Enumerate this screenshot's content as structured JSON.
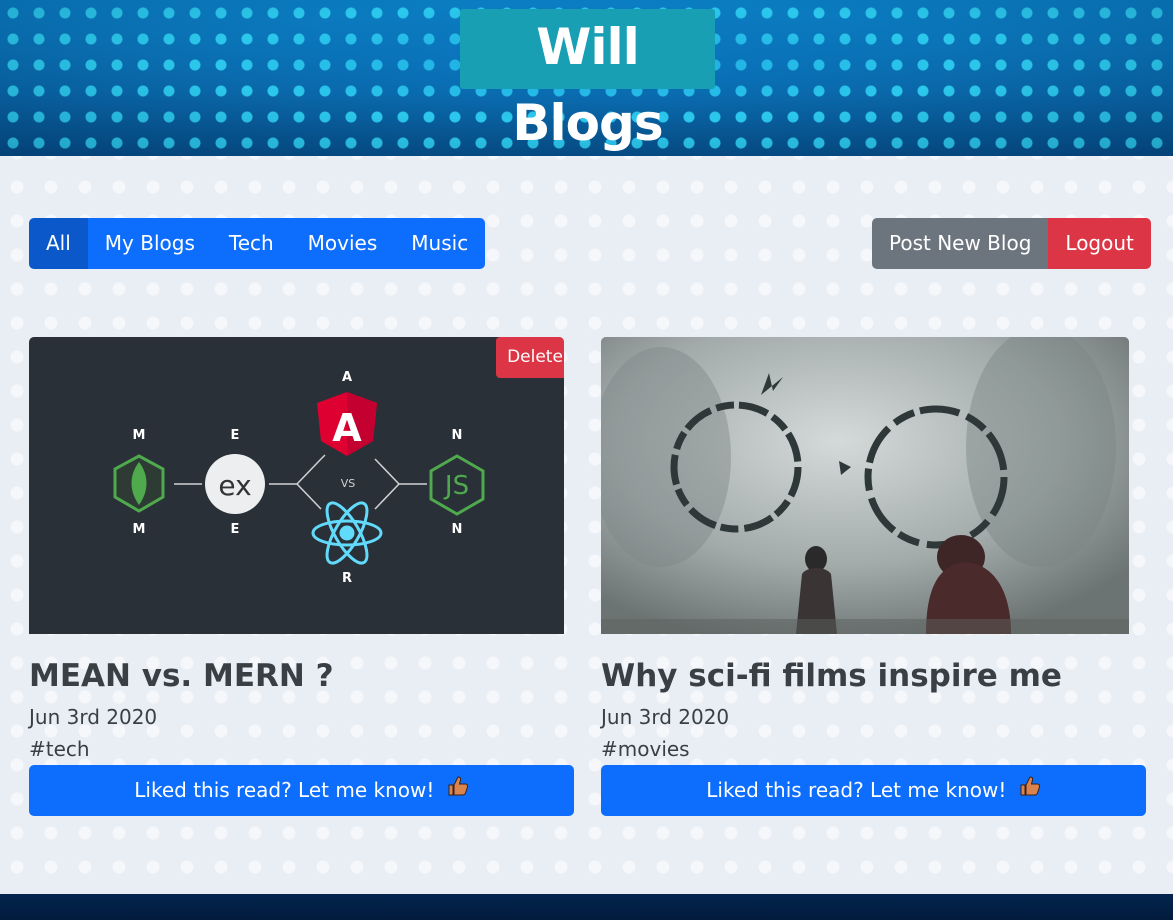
{
  "site": {
    "title": "Will Blogs"
  },
  "filters": [
    {
      "label": "All",
      "active": true
    },
    {
      "label": "My Blogs",
      "active": false
    },
    {
      "label": "Tech",
      "active": false
    },
    {
      "label": "Movies",
      "active": false
    },
    {
      "label": "Music",
      "active": false
    }
  ],
  "actions": {
    "post_label": "Post New Blog",
    "logout_label": "Logout"
  },
  "posts": [
    {
      "title": "MEAN vs. MERN ?",
      "date": "Jun 3rd 2020",
      "tag": "#tech",
      "delete_label": "Delete",
      "like_label": "Liked this read? Let me know!",
      "image": {
        "top_letter": "A",
        "left_letters": [
          "M",
          "E"
        ],
        "right_letter": "N",
        "bottom_letter": "R",
        "ex_label": "ex",
        "vs_label": "VS",
        "js_label": "JS",
        "angular_letter": "A"
      }
    },
    {
      "title": "Why sci-fi films inspire me",
      "date": "Jun 3rd 2020",
      "tag": "#movies",
      "like_label": "Liked this read? Let me know!"
    }
  ],
  "colors": {
    "primary": "#0d6efd",
    "danger": "#dc3545",
    "secondary": "#6c757d",
    "title_bg": "#189fb3"
  }
}
